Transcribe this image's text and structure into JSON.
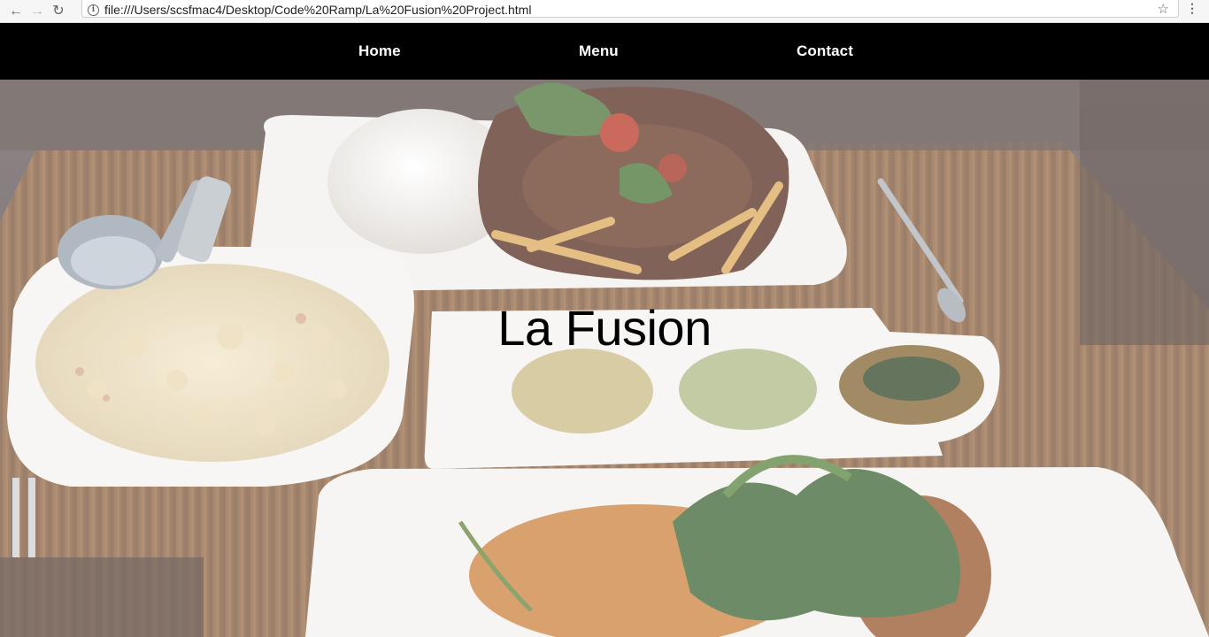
{
  "browser": {
    "url": "file:///Users/scsfmac4/Desktop/Code%20Ramp/La%20Fusion%20Project.html",
    "back_icon": "arrow-left",
    "forward_icon": "arrow-right",
    "reload_icon": "reload",
    "info_icon": "info-circle",
    "bookmark_icon": "star-outline",
    "menu_icon": "vertical-ellipsis"
  },
  "nav": {
    "items": [
      {
        "label": "Home"
      },
      {
        "label": "Menu"
      },
      {
        "label": "Contact"
      }
    ],
    "background": "#000000",
    "text_color": "#ffffff"
  },
  "hero": {
    "title": "La Fusion",
    "image_subject": "restaurant dishes on a wooden table"
  }
}
